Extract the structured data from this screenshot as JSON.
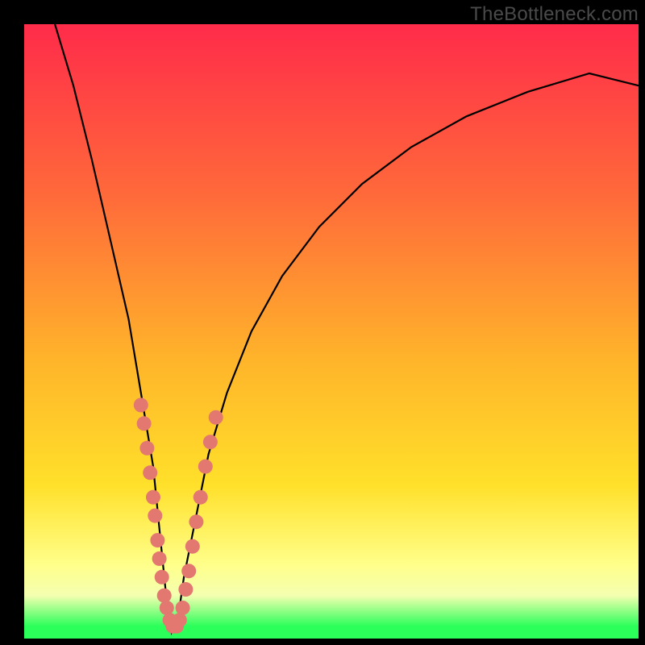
{
  "watermark": "TheBottleneck.com",
  "colors": {
    "top": "#ff2b4a",
    "upper": "#ff6a3a",
    "mid": "#ffb52a",
    "lowmid": "#ffe02a",
    "pale": "#ffff8a",
    "pale2": "#f4ffb0",
    "green": "#2bff5a",
    "marker": "#e2786f",
    "curve": "#000000"
  },
  "chart_data": {
    "type": "line",
    "title": "",
    "xlabel": "",
    "ylabel": "",
    "xlim": [
      0,
      100
    ],
    "ylim": [
      0,
      100
    ],
    "grid": false,
    "legend": false,
    "note": "V-shaped bottleneck curve. x is relative component balance (arbitrary 0–100), y is bottleneck severity % (0 = none, 100 = full). Minimum near x≈24. Values estimated from pixel positions.",
    "series": [
      {
        "name": "bottleneck-curve",
        "x": [
          5,
          8,
          11,
          14,
          17,
          19,
          21,
          22,
          23,
          24,
          25,
          26,
          28,
          30,
          33,
          37,
          42,
          48,
          55,
          63,
          72,
          82,
          92,
          100
        ],
        "y": [
          100,
          90,
          78,
          65,
          52,
          40,
          28,
          18,
          8,
          1,
          3,
          10,
          20,
          30,
          40,
          50,
          59,
          67,
          74,
          80,
          85,
          89,
          92,
          90
        ]
      }
    ],
    "markers": {
      "name": "highlighted-points",
      "note": "Salmon dots clustered on both arms of the V near the bottom third",
      "points": [
        {
          "x": 19.0,
          "y": 38
        },
        {
          "x": 19.5,
          "y": 35
        },
        {
          "x": 20.0,
          "y": 31
        },
        {
          "x": 20.5,
          "y": 27
        },
        {
          "x": 21.0,
          "y": 23
        },
        {
          "x": 21.3,
          "y": 20
        },
        {
          "x": 21.7,
          "y": 16
        },
        {
          "x": 22.0,
          "y": 13
        },
        {
          "x": 22.4,
          "y": 10
        },
        {
          "x": 22.8,
          "y": 7
        },
        {
          "x": 23.2,
          "y": 5
        },
        {
          "x": 23.7,
          "y": 3
        },
        {
          "x": 24.2,
          "y": 2
        },
        {
          "x": 24.8,
          "y": 2
        },
        {
          "x": 25.3,
          "y": 3
        },
        {
          "x": 25.8,
          "y": 5
        },
        {
          "x": 26.3,
          "y": 8
        },
        {
          "x": 26.8,
          "y": 11
        },
        {
          "x": 27.4,
          "y": 15
        },
        {
          "x": 28.0,
          "y": 19
        },
        {
          "x": 28.7,
          "y": 23
        },
        {
          "x": 29.5,
          "y": 28
        },
        {
          "x": 30.3,
          "y": 32
        },
        {
          "x": 31.2,
          "y": 36
        }
      ]
    }
  }
}
